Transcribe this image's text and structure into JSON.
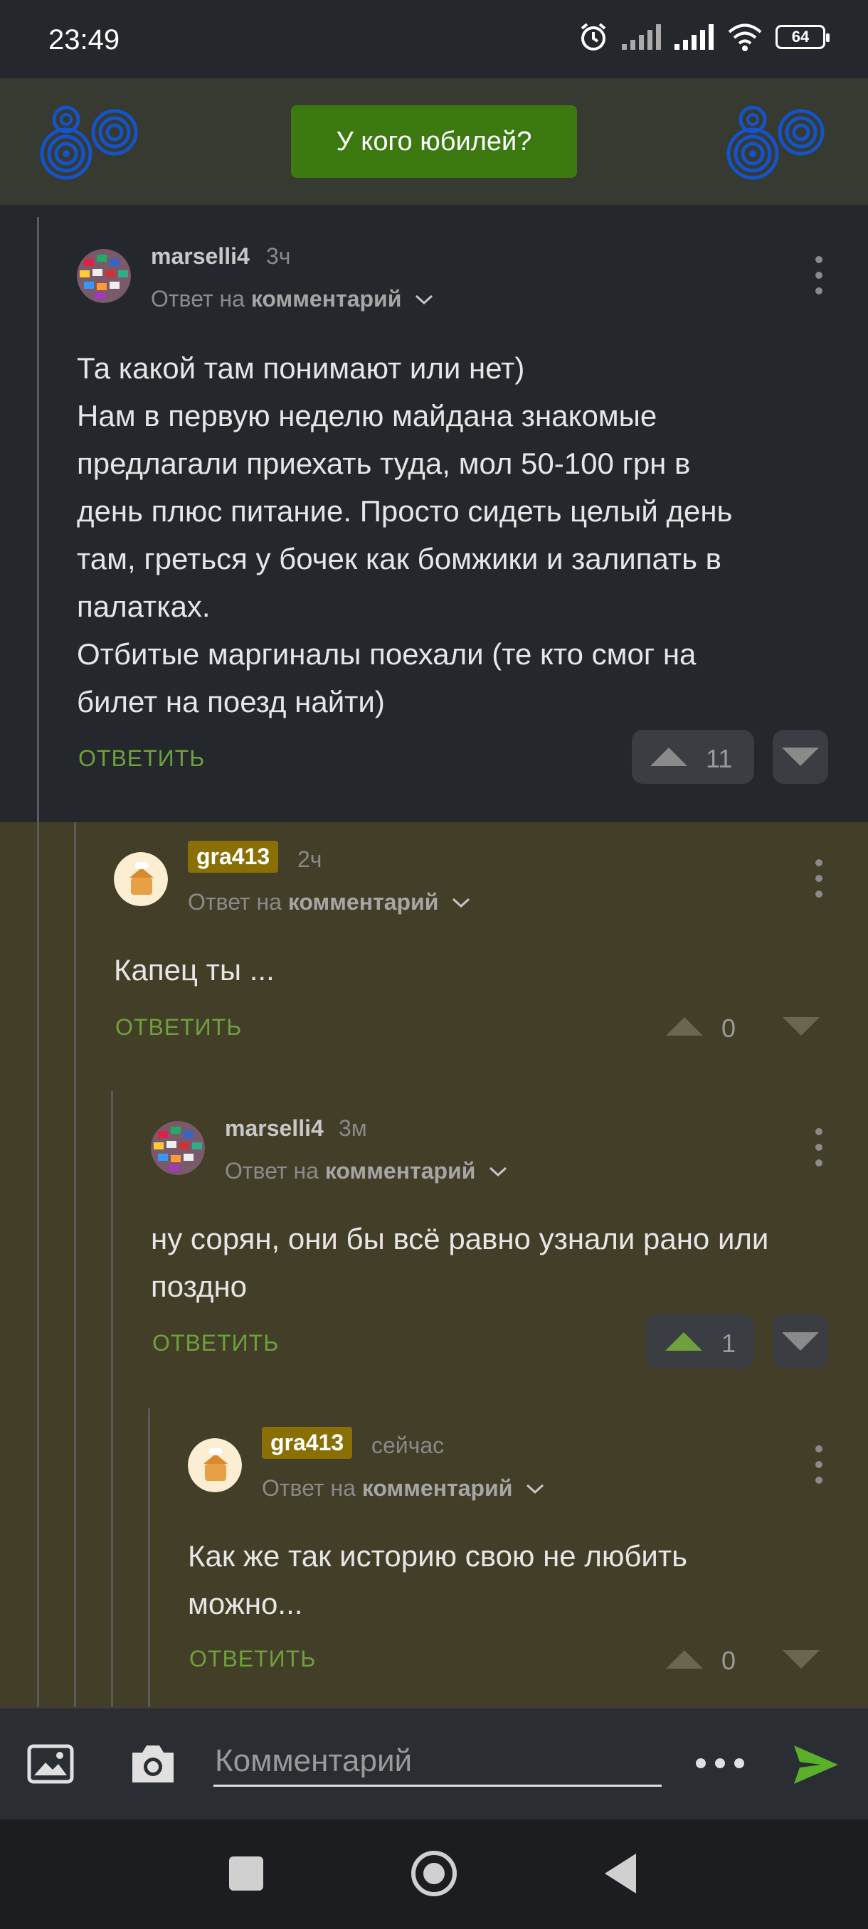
{
  "status_bar": {
    "time": "23:49",
    "battery": "64"
  },
  "banner": {
    "button_label": "У кого юбилей?"
  },
  "comments": [
    {
      "username": "marselli4",
      "time_ago": "3ч",
      "reply_prefix": "Ответ на ",
      "reply_target": "комментарий",
      "lines": [
        "Та какой там понимают или нет)",
        "Нам в первую неделю майдана знакомые",
        "предлагали приехать туда, мол 50-100 грн в",
        "день плюс питание. Просто сидеть целый день",
        "там, греться у бочек как бомжики и залипать в",
        "палатках.",
        "Отбитые маргиналы поехали (те кто смог на",
        "билет на поезд найти)"
      ],
      "reply_label": "ОТВЕТИТЬ",
      "votes": "11"
    },
    {
      "username": "gra413",
      "time_ago": "2ч",
      "reply_prefix": "Ответ на ",
      "reply_target": "комментарий",
      "lines": [
        "Капец ты ..."
      ],
      "reply_label": "ОТВЕТИТЬ",
      "votes": "0"
    },
    {
      "username": "marselli4",
      "time_ago": "3м",
      "reply_prefix": "Ответ на ",
      "reply_target": "комментарий",
      "lines": [
        "ну сорян, они бы всё равно узнали рано или",
        "поздно"
      ],
      "reply_label": "ОТВЕТИТЬ",
      "votes": "1"
    },
    {
      "username": "gra413",
      "time_ago": "сейчас",
      "reply_prefix": "Ответ на ",
      "reply_target": "комментарий",
      "lines": [
        "Как же так историю свою не любить",
        "можно..."
      ],
      "reply_label": "ОТВЕТИТЬ",
      "votes": "0"
    }
  ],
  "composer": {
    "placeholder": "Комментарий"
  },
  "colors": {
    "accent_green": "#6ea03c",
    "op_badge": "#8a6f05",
    "upvoted": "#6ea03c"
  }
}
